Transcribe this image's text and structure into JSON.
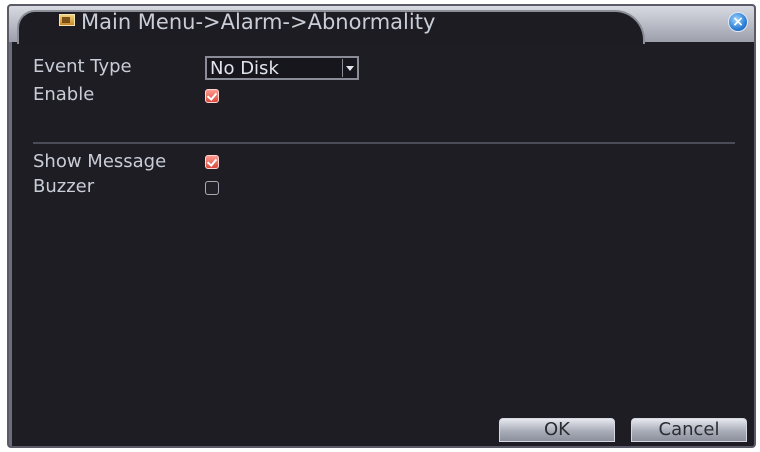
{
  "window": {
    "title": "Main Menu->Alarm->Abnormality",
    "close_label": "×"
  },
  "form": {
    "event_type_label": "Event Type",
    "event_type_value": "No Disk",
    "enable_label": "Enable",
    "enable_checked": true,
    "show_message_label": "Show Message",
    "show_message_checked": true,
    "buzzer_label": "Buzzer",
    "buzzer_checked": false
  },
  "buttons": {
    "ok_label": "OK",
    "cancel_label": "Cancel"
  },
  "colors": {
    "background": "#1e1d23",
    "text": "#c9cdd8",
    "checkbox_checked": "#d94a3e"
  }
}
